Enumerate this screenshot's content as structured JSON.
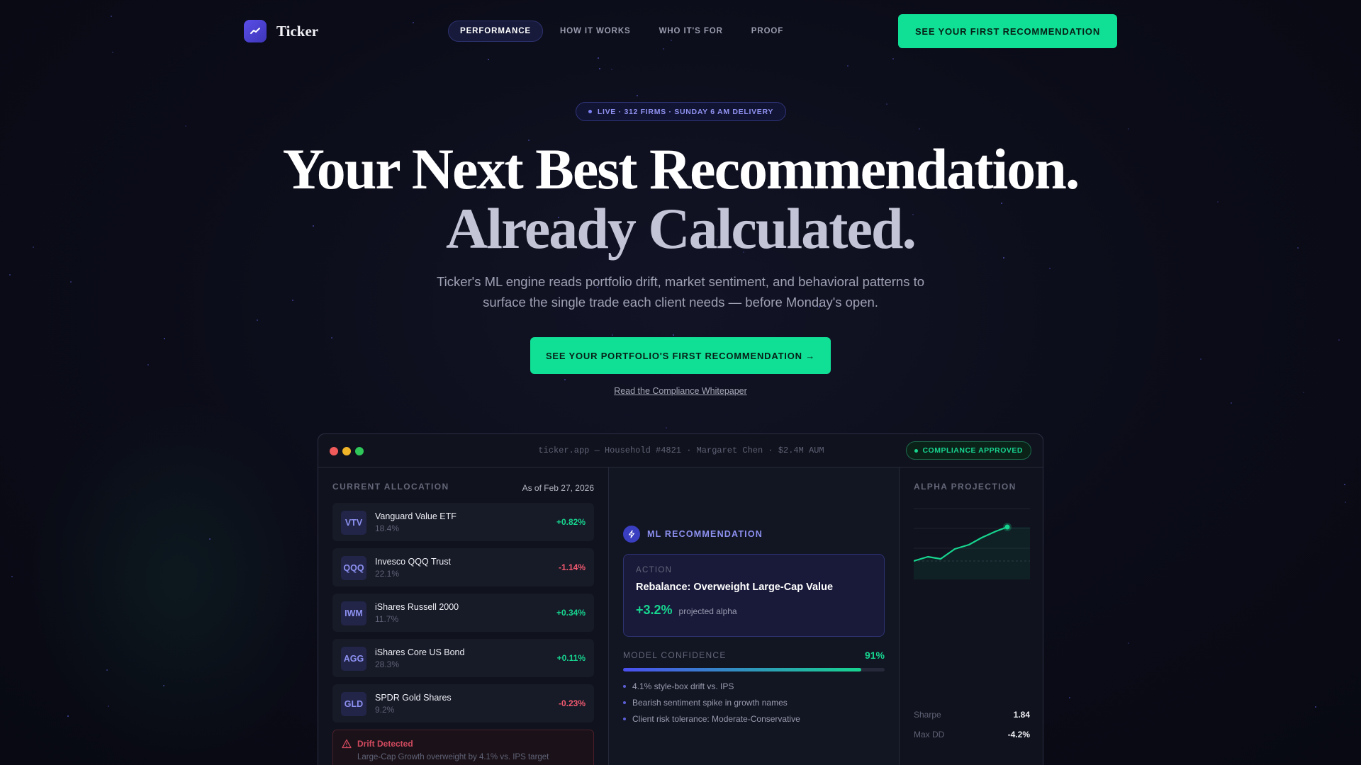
{
  "brand": {
    "name": "Ticker"
  },
  "nav": {
    "links": [
      "PERFORMANCE",
      "HOW IT WORKS",
      "WHO IT'S FOR",
      "PROOF"
    ],
    "cta": "SEE YOUR FIRST RECOMMENDATION"
  },
  "hero": {
    "badge": "LIVE · 312 FIRMS · SUNDAY 6 AM DELIVERY",
    "headline_1": "Your Next Best Recommendation.",
    "headline_2": "Already Calculated.",
    "subtitle": "Ticker's ML engine reads portfolio drift, market sentiment, and behavioral patterns to surface the single trade each client needs — before Monday's open.",
    "cta": "SEE YOUR PORTFOLIO'S FIRST RECOMMENDATION →",
    "secondary_link": "Read the Compliance Whitepaper"
  },
  "window": {
    "title": "ticker.app — Household #4821 · Margaret Chen · $2.4M AUM",
    "compliance_badge": "COMPLIANCE APPROVED"
  },
  "allocation": {
    "label": "CURRENT ALLOCATION",
    "as_of": "As of Feb 27, 2026",
    "holdings": [
      {
        "ticker": "VTV",
        "name": "Vanguard Value ETF",
        "pct": "18.4%",
        "change": "+0.82%"
      },
      {
        "ticker": "QQQ",
        "name": "Invesco QQQ Trust",
        "pct": "22.1%",
        "change": "-1.14%"
      },
      {
        "ticker": "IWM",
        "name": "iShares Russell 2000",
        "pct": "11.7%",
        "change": "+0.34%"
      },
      {
        "ticker": "AGG",
        "name": "iShares Core US Bond",
        "pct": "28.3%",
        "change": "+0.11%"
      },
      {
        "ticker": "GLD",
        "name": "SPDR Gold Shares",
        "pct": "9.2%",
        "change": "-0.23%"
      }
    ],
    "drift_title": "Drift Detected",
    "drift_text": "Large-Cap Growth overweight by 4.1% vs. IPS target"
  },
  "recommendation": {
    "label": "ML RECOMMENDATION",
    "action_label": "ACTION",
    "action": "Rebalance: Overweight Large-Cap Value",
    "alpha": "+3.2%",
    "alpha_label": "projected alpha",
    "confidence_label": "MODEL CONFIDENCE",
    "confidence": "91%",
    "confidence_value": 0.91,
    "reasons": [
      "4.1% style-box drift vs. IPS",
      "Bearish sentiment spike in growth names",
      "Client risk tolerance: Moderate-Conservative"
    ]
  },
  "projection": {
    "label": "ALPHA PROJECTION",
    "stats": [
      {
        "key": "Sharpe",
        "value": "1.84"
      },
      {
        "key": "Max DD",
        "value": "-4.2%"
      }
    ]
  },
  "colors": {
    "accent": "#10e096",
    "brand": "#5a4ee8",
    "positive": "#17d48f",
    "negative": "#f05a70"
  },
  "icons": [
    "trend-icon",
    "bolt-icon",
    "warning-icon"
  ]
}
